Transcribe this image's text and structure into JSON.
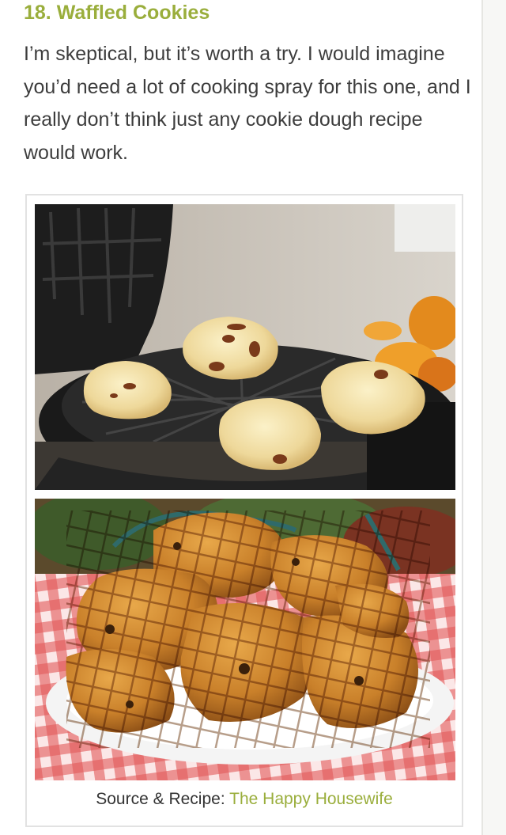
{
  "article": {
    "heading": "18. Waffled Cookies",
    "paragraph": "I’m skeptical, but it’s worth a try. I would imagine you’d need a lot of cooking spray for this one, and I really don’t think just any cookie dough recipe would work."
  },
  "figure": {
    "caption_prefix": "Source & Recipe:",
    "caption_link": "The Happy Housewife"
  },
  "colors": {
    "accent": "#9aae3c",
    "text": "#3d3d3d"
  }
}
